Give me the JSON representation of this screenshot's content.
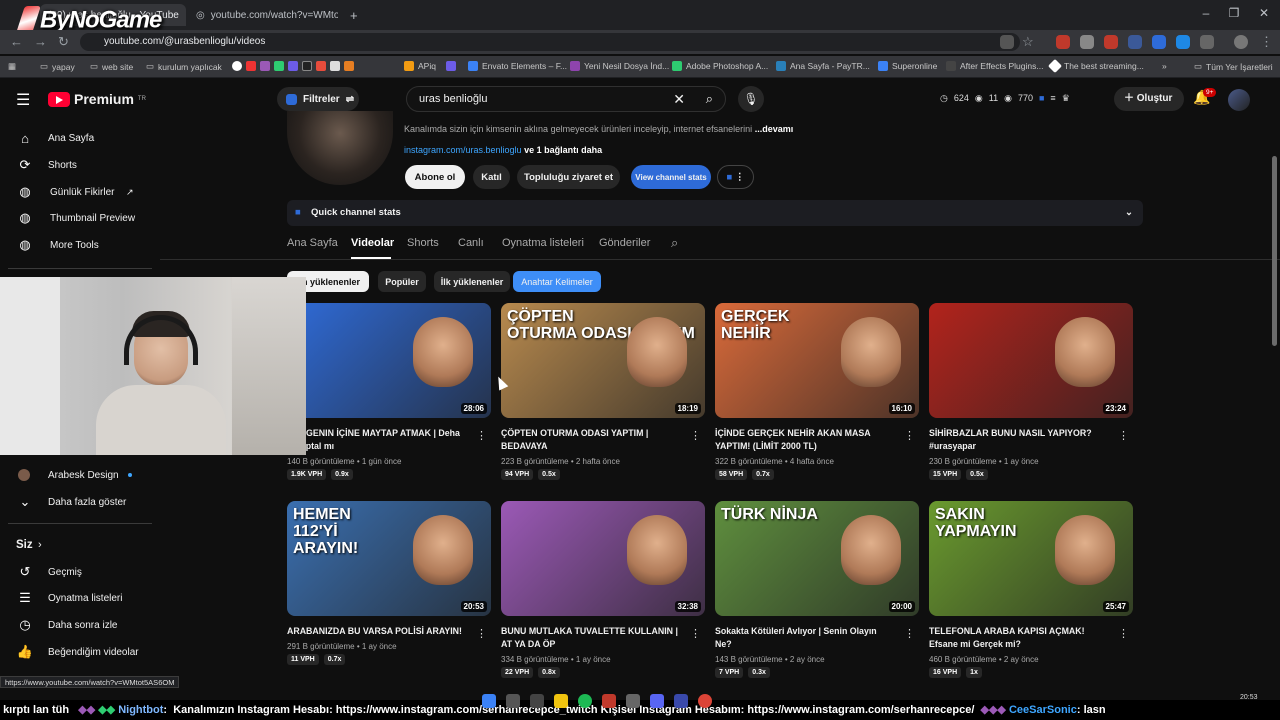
{
  "overlay": {
    "logo_text": "ByNoGame"
  },
  "browser": {
    "tabs": [
      {
        "title": "(20) uras benlioğlu - YouTube",
        "active": true
      },
      {
        "title": "youtube.com/watch?v=WMtotS",
        "active": false
      }
    ],
    "new_tab": "+",
    "url": "youtube.com/@urasbenlioglu/videos",
    "bookmarks": [
      "yapay",
      "web site",
      "kurulum yaplıcak",
      "APiq",
      "Envato Elements – F...",
      "Yeni Nesil Dosya İnd...",
      "Adobe Photoshop A...",
      "Ana Sayfa - PayTR...",
      "Superonline",
      "After Effects Plugins...",
      "The best streaming...",
      "Tüm Yer İşaretleri"
    ]
  },
  "youtube": {
    "logo": "Premium",
    "logo_sup": "TR",
    "filter_label": "Filtreler",
    "search_query": "uras benlioğlu",
    "stats": {
      "a": "624",
      "b": "11",
      "c": "770"
    },
    "create_label": "Oluştur",
    "notif_badge": "9+"
  },
  "sidebar": {
    "items": [
      {
        "label": "Ana Sayfa",
        "icon": "home-icon"
      },
      {
        "label": "Shorts",
        "icon": "shorts-icon"
      },
      {
        "label": "Günlük Fikirler",
        "icon": "idea-icon"
      },
      {
        "label": "Thumbnail Preview",
        "icon": "preview-icon"
      },
      {
        "label": "More Tools",
        "icon": "tools-icon"
      }
    ],
    "subscription": "Arabesk Design",
    "show_more": "Daha fazla göster",
    "you_header": "Siz",
    "you_items": [
      {
        "label": "Geçmiş",
        "icon": "history-icon"
      },
      {
        "label": "Oynatma listeleri",
        "icon": "playlist-icon"
      },
      {
        "label": "Daha sonra izle",
        "icon": "clock-icon"
      },
      {
        "label": "Beğendiğim videolar",
        "icon": "like-icon"
      }
    ]
  },
  "channel": {
    "description": "Kanalımda sizin için kimsenin aklına gelmeyecek ürünleri inceleyip, internet efsanelerini",
    "more": "...devamı",
    "link": "instagram.com/uras.benlioglu",
    "link_more": "ve 1 bağlantı daha",
    "buttons": {
      "subscribe": "Abone ol",
      "join": "Katıl",
      "community": "Topluluğu ziyaret et",
      "stats": "View channel stats"
    },
    "quick_stats": "Quick channel stats",
    "tabs": [
      "Ana Sayfa",
      "Videolar",
      "Shorts",
      "Canlı",
      "Oynatma listeleri",
      "Gönderiler"
    ],
    "active_tab": "Videolar",
    "chips": [
      "En yüklenenler",
      "Popüler",
      "İlk yüklenenler",
      "Anahtar Kelimeler"
    ]
  },
  "videos": [
    {
      "title": "BÜRGENIN İÇİNE MAYTAP ATMAK | Deha mı Aptal mı",
      "views": "140 B görüntüleme",
      "age": "1 gün önce",
      "vph": "1.9K VPH",
      "ratio": "0.9x",
      "duration": "28:06",
      "thumb_text": "",
      "color": "#2f6bd8"
    },
    {
      "title": "ÇÖPTEN OTURMA ODASI YAPTIM | BEDAVAYA",
      "views": "223 B görüntüleme",
      "age": "2 hafta önce",
      "vph": "94 VPH",
      "ratio": "0.5x",
      "duration": "18:19",
      "thumb_text": "ÇÖPTEN\nOTURMA ODASI YAPTIM",
      "color": "#b88a4e"
    },
    {
      "title": "İÇİNDE GERÇEK NEHİR AKAN MASA YAPTIM! (LİMİT 2000 TL)",
      "views": "322 B görüntüleme",
      "age": "4 hafta önce",
      "vph": "58 VPH",
      "ratio": "0.7x",
      "duration": "16:10",
      "thumb_text": "GERÇEK\nNEHİR",
      "color": "#d96a3a"
    },
    {
      "title": "SİHİRBAZLAR BUNU NASIL YAPIYOR? #urasyapar",
      "views": "230 B görüntüleme",
      "age": "1 ay önce",
      "vph": "15 VPH",
      "ratio": "0.5x",
      "duration": "23:24",
      "thumb_text": "",
      "color": "#b2231c"
    },
    {
      "title": "ARABANIZDA BU VARSA POLİSİ ARAYIN!",
      "views": "291 B görüntüleme",
      "age": "1 ay önce",
      "vph": "11 VPH",
      "ratio": "0.7x",
      "duration": "20:53",
      "thumb_text": "HEMEN\n112'Yİ\nARAYIN!",
      "color": "#3a6fb0"
    },
    {
      "title": "BUNU MUTLAKA TUVALETTE KULLANIN | AT YA DA ÖP",
      "views": "334 B görüntüleme",
      "age": "1 ay önce",
      "vph": "22 VPH",
      "ratio": "0.8x",
      "duration": "32:38",
      "thumb_text": "",
      "color": "#9b59b6"
    },
    {
      "title": "Sokakta Kötüleri Avlıyor | Senin Olayın Ne?",
      "views": "143 B görüntüleme",
      "age": "2 ay önce",
      "vph": "7 VPH",
      "ratio": "0.3x",
      "duration": "20:00",
      "thumb_text": "TÜRK NİNJA",
      "color": "#5f8f3e"
    },
    {
      "title": "TELEFONLA ARABA KAPISI AÇMAK! Efsane mi Gerçek mi?",
      "views": "460 B görüntüleme",
      "age": "2 ay önce",
      "vph": "16 VPH",
      "ratio": "1x",
      "duration": "25:47",
      "thumb_text": "SAKIN\nYAPMAYIN",
      "color": "#6a9a2e"
    }
  ],
  "status_url": "https://www.youtube.com/watch?v=WMtot5AS6OM",
  "ticker": {
    "prefix": "kırptı lan tüh",
    "bot": "Nightbot",
    "message": "Kanalımızın Instagram Hesabı: https://www.instagram.com/serhanrecepce_twitch Kişisel Instagram Hesabım: https://www.instagram.com/serhanrecepce/",
    "user": "CeeSarSonic",
    "tail": "lasn"
  },
  "clock": "20:53"
}
